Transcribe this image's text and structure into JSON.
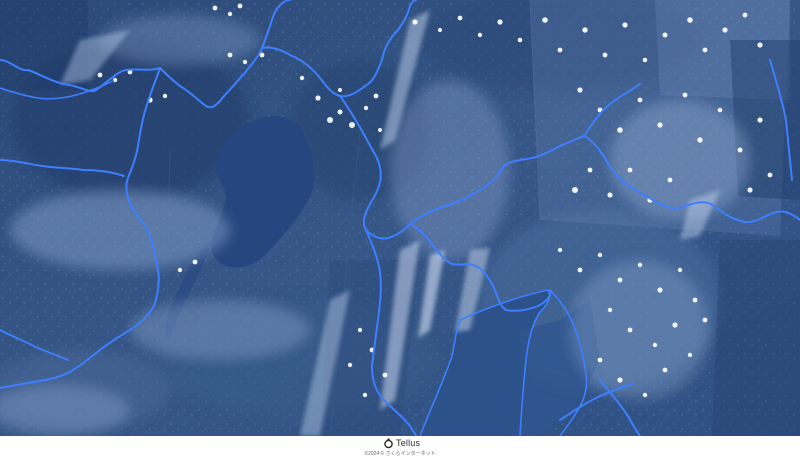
{
  "map": {
    "type": "satellite-imagery",
    "boundary_color": "#3d7fff",
    "water_color": "#25467e"
  },
  "footer": {
    "logo_icon": "tellus-logo-icon",
    "logo_text": "Tellus",
    "copyright": "©2024 © さくらインターネット"
  }
}
